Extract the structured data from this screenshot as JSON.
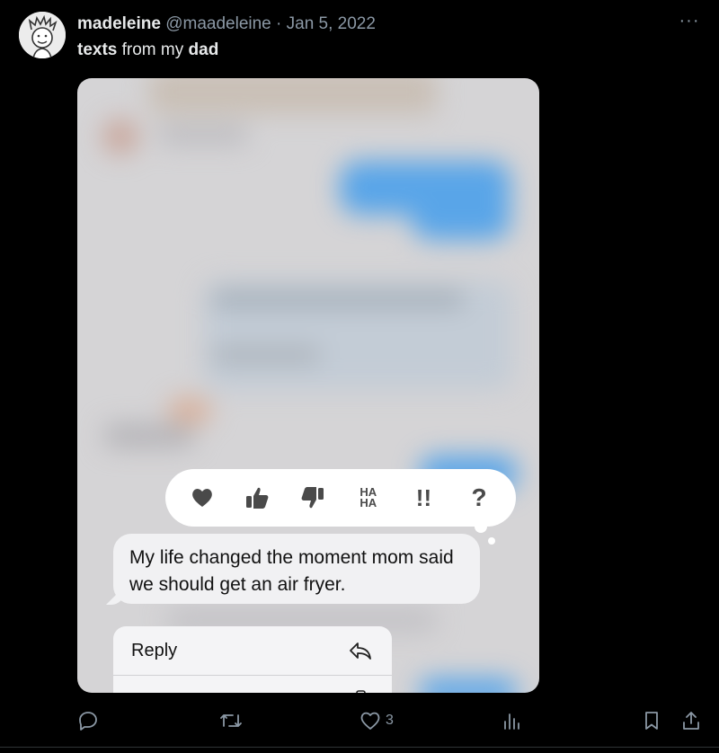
{
  "tweet": {
    "display_name": "madeleine",
    "handle": "@maadeleine",
    "separator": "·",
    "date": "Jan 5, 2022",
    "text_parts": [
      "texts",
      " from my ",
      "dad"
    ]
  },
  "media": {
    "message_text": "My life changed the moment mom said we should get an air fryer.",
    "reactions": [
      "heart-icon",
      "thumbs-up-icon",
      "thumbs-down-icon",
      "haha-icon",
      "exclamation-icon",
      "question-icon"
    ],
    "haha_label_top": "HA",
    "haha_label_bottom": "HA",
    "exclaim_label": "!!",
    "question_label": "?",
    "menu": {
      "reply_label": "Reply"
    },
    "bubble_colors": {
      "blue": "#59a5e8",
      "grey": "#d5d4d6"
    }
  },
  "actions": {
    "likes": "3"
  },
  "colors": {
    "background": "#000000",
    "text": "#e7e9ea",
    "muted": "#8b98a5"
  }
}
